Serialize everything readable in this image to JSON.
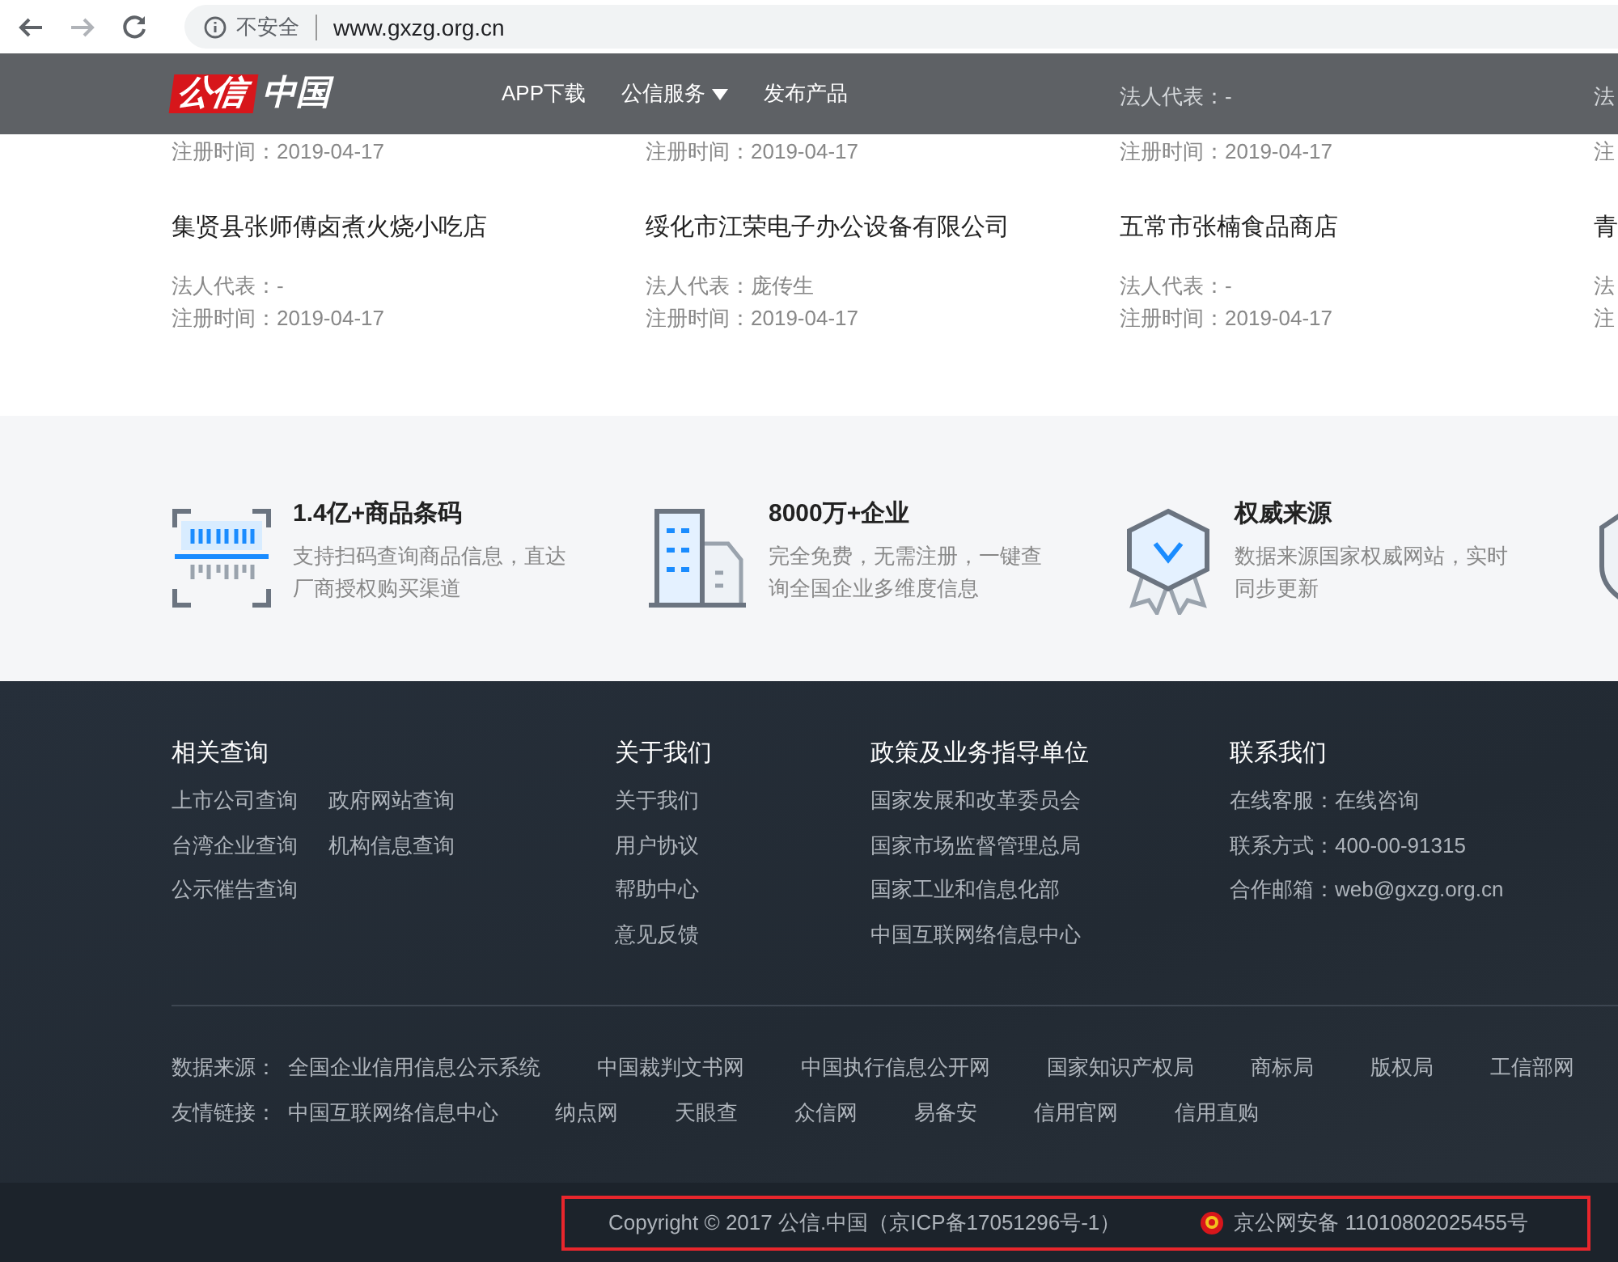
{
  "browser": {
    "security": "不安全",
    "url": "www.gxzg.org.cn"
  },
  "header": {
    "logo": [
      "公信",
      "中国"
    ],
    "nav": [
      {
        "label": "APP下载",
        "dropdown": false
      },
      {
        "label": "公信服务",
        "dropdown": true
      },
      {
        "label": "发布产品",
        "dropdown": false
      }
    ]
  },
  "company_rows": [
    [
      {
        "registered": "注册时间：2019-04-17"
      },
      {
        "registered": "注册时间：2019-04-17"
      },
      {
        "legal_rep": "法人代表：-",
        "registered": "注册时间：2019-04-17"
      },
      {
        "legal_rep": "法",
        "registered": "注"
      }
    ],
    [
      {
        "name": "集贤县张师傅卤煮火烧小吃店",
        "legal_rep": "法人代表：-",
        "registered": "注册时间：2019-04-17"
      },
      {
        "name": "绥化市江荣电子办公设备有限公司",
        "legal_rep": "法人代表：庞传生",
        "registered": "注册时间：2019-04-17"
      },
      {
        "name": "五常市张楠食品商店",
        "legal_rep": "法人代表：-",
        "registered": "注册时间：2019-04-17"
      },
      {
        "name": "青",
        "legal_rep": "法",
        "registered": "注"
      }
    ]
  ],
  "features": [
    {
      "kind": "barcode",
      "title": "1.4亿+商品条码",
      "text": "支持扫码查询商品信息，直达厂商授权购买渠道"
    },
    {
      "kind": "building",
      "title": "8000万+企业",
      "text": "完全免费，无需注册，一键查询全国企业多维度信息"
    },
    {
      "kind": "badge",
      "title": "权威来源",
      "text": "数据来源国家权威网站，实时同步更新"
    },
    {
      "kind": "shield"
    }
  ],
  "footer": {
    "columns": [
      {
        "title": "相关查询",
        "rows": [
          [
            "上市公司查询",
            "政府网站查询"
          ],
          [
            "台湾企业查询",
            "机构信息查询"
          ],
          [
            "公示催告查询"
          ]
        ]
      },
      {
        "title": "关于我们",
        "rows": [
          [
            "关于我们"
          ],
          [
            "用户协议"
          ],
          [
            "帮助中心"
          ],
          [
            "意见反馈"
          ]
        ]
      },
      {
        "title": "政策及业务指导单位",
        "rows": [
          [
            "国家发展和改革委员会"
          ],
          [
            "国家市场监督管理总局"
          ],
          [
            "国家工业和信息化部"
          ],
          [
            "中国互联网络信息中心"
          ]
        ]
      },
      {
        "title": "联系我们",
        "rows": [
          [
            "在线客服：在线咨询"
          ],
          [
            "联系方式：400-00-91315"
          ],
          [
            "合作邮箱：web@gxzg.org.cn"
          ]
        ]
      }
    ],
    "link_rows": [
      {
        "label": "数据来源：",
        "links": [
          "全国企业信用信息公示系统",
          "中国裁判文书网",
          "中国执行信息公开网",
          "国家知识产权局",
          "商标局",
          "版权局",
          "工信部网"
        ]
      },
      {
        "label": "友情链接：",
        "links": [
          "中国互联网络信息中心",
          "纳点网",
          "天眼查",
          "众信网",
          "易备安",
          "信用官网",
          "信用直购"
        ]
      }
    ]
  },
  "bottom": {
    "copyright": "Copyright © 2017 公信.中国（京ICP备17051296号-1）",
    "police_record": "京公网安备 11010802025455号",
    "highlighted": true
  }
}
